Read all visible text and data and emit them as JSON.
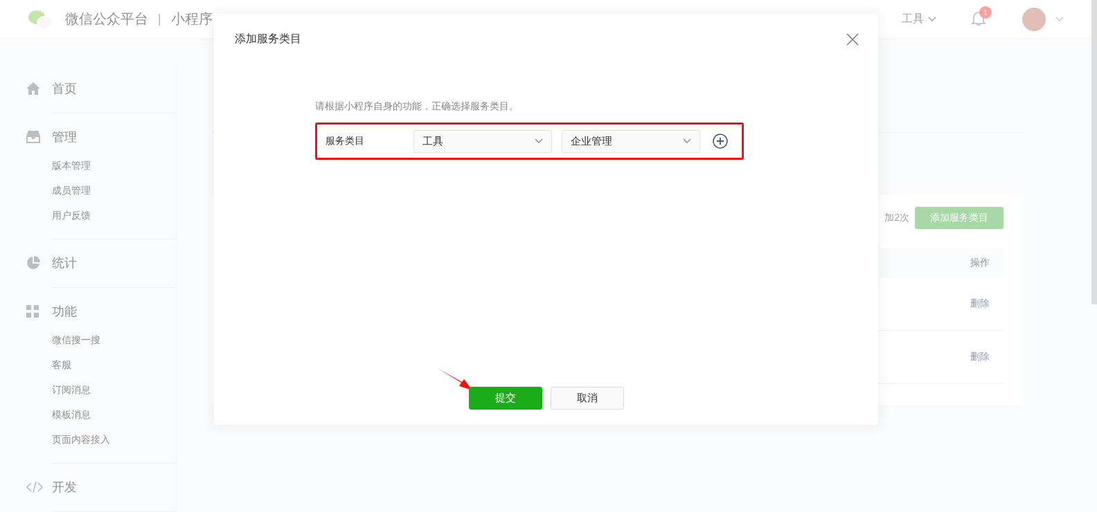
{
  "header": {
    "brand": "微信公众平台",
    "separator": "|",
    "product": "小程序",
    "menu": "工具",
    "notification_count": "1"
  },
  "sidebar": {
    "sections": [
      {
        "label": "首页"
      },
      {
        "label": "管理",
        "children": [
          {
            "label": "版本管理"
          },
          {
            "label": "成员管理"
          },
          {
            "label": "用户反馈"
          }
        ]
      },
      {
        "label": "统计"
      },
      {
        "label": "功能",
        "children": [
          {
            "label": "微信搜一搜"
          },
          {
            "label": "客服"
          },
          {
            "label": "订阅消息"
          },
          {
            "label": "模板消息"
          },
          {
            "label": "页面内容接入"
          }
        ]
      },
      {
        "label": "开发"
      }
    ]
  },
  "main": {
    "quota_note": "加2次",
    "add_button": {
      "label": "添加服务类目",
      "disabled": true
    },
    "table": {
      "columns": [
        {
          "label": "操作"
        }
      ],
      "rows": [
        {
          "action": "删除"
        },
        {
          "action": "删除"
        }
      ]
    }
  },
  "dialog": {
    "title": "添加服务类目",
    "hint": "请根据小程序自身的功能，正确选择服务类目。",
    "field_label": "服务类目",
    "highlighted": true,
    "selects": [
      {
        "value": "工具"
      },
      {
        "value": "企业管理"
      }
    ],
    "buttons": [
      {
        "label": "提交",
        "kind": "primary"
      },
      {
        "label": "取消",
        "kind": "default"
      }
    ],
    "arrow": true
  }
}
